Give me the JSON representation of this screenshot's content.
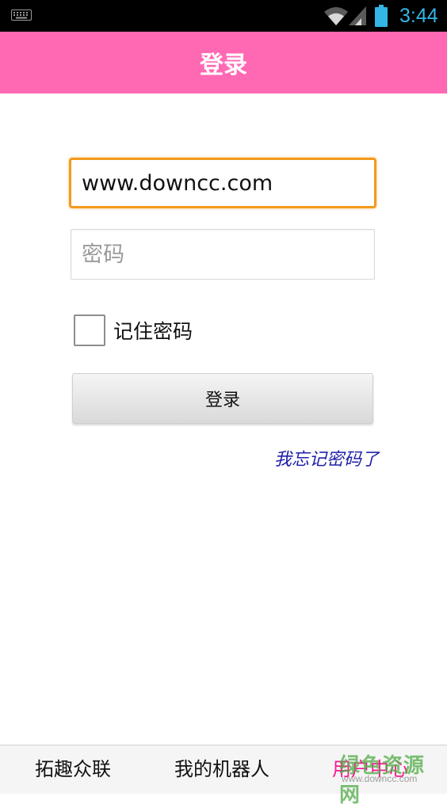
{
  "status_bar": {
    "time": "3:44",
    "icons": [
      "keyboard-icon",
      "wifi-icon",
      "signal-icon",
      "battery-icon"
    ],
    "time_color": "#33b5e5"
  },
  "header": {
    "title": "登录",
    "background": "#ff69b4"
  },
  "form": {
    "username_value": "www.downcc.com",
    "password_placeholder": "密码",
    "remember_label": "记住密码",
    "remember_checked": false,
    "login_button": "登录",
    "forgot_link": "我忘记密码了"
  },
  "bottom_nav": {
    "items": [
      {
        "label": "拓趣众联",
        "active": false
      },
      {
        "label": "我的机器人",
        "active": false
      },
      {
        "label": "用户中心",
        "active": true
      }
    ],
    "active_color": "#ff1493"
  },
  "watermark": {
    "title": "绿色资源网",
    "url": "www.downcc.com"
  }
}
